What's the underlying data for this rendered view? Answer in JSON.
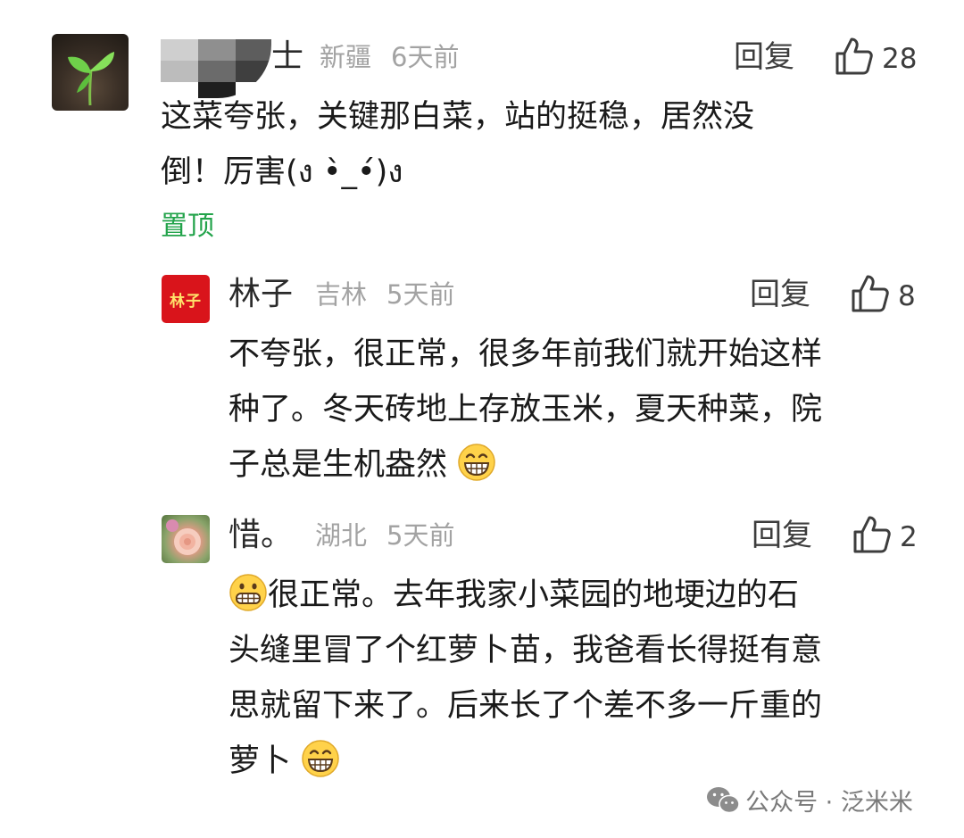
{
  "comments": [
    {
      "name": "士",
      "location": "新疆",
      "time": "6天前",
      "reply_label": "回复",
      "likes": "28",
      "lines": [
        "这菜夸张，关键那白菜，站的挺稳，居然没",
        "倒！厉害(ง •̀_•́)ง"
      ],
      "pinned_label": "置顶"
    },
    {
      "name": "林子",
      "avatar_text": "林子",
      "location": "吉林",
      "time": "5天前",
      "reply_label": "回复",
      "likes": "8",
      "lines": [
        "不夸张，很正常，很多年前我们就开始这样",
        "种了。冬天砖地上存放玉米，夏天种菜，院",
        "子总是生机盎然"
      ]
    },
    {
      "name": "惜。",
      "location": "湖北",
      "time": "5天前",
      "reply_label": "回复",
      "likes": "2",
      "lines": [
        "很正常。去年我家小菜园的地埂边的石",
        "头缝里冒了个红萝卜苗，我爸看长得挺有意",
        "思就留下来了。后来长了个差不多一斤重的",
        "萝卜"
      ]
    }
  ],
  "watermark": {
    "text": "公众号 · 泛米米"
  },
  "icons": {
    "like": "thumbs-up-icon",
    "grin": "grinning-emoji-icon",
    "grimace": "grimacing-emoji-icon",
    "wechat": "wechat-icon"
  }
}
